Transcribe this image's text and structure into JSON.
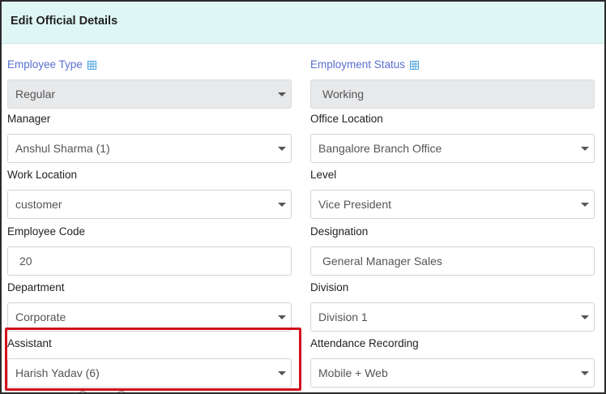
{
  "header": {
    "title": "Edit Official Details"
  },
  "fields": [
    {
      "label": "Employee Type",
      "value": "Regular",
      "kind": "select",
      "disabled": true,
      "label_color": "blue",
      "label_icon": "grid-icon"
    },
    {
      "label": "Employment Status",
      "value": "Working",
      "kind": "text",
      "disabled": true,
      "label_color": "blue",
      "label_icon": "grid-icon"
    },
    {
      "label": "Manager",
      "value": "Anshul Sharma (1)",
      "kind": "select"
    },
    {
      "label": "Office Location",
      "value": "Bangalore Branch Office",
      "kind": "select"
    },
    {
      "label": "Work Location",
      "value": "customer",
      "kind": "select"
    },
    {
      "label": "Level",
      "value": "Vice President",
      "kind": "select"
    },
    {
      "label": "Employee Code",
      "value": "20",
      "kind": "text"
    },
    {
      "label": "Designation",
      "value": "General Manager Sales",
      "kind": "text"
    },
    {
      "label": "Department",
      "value": "Corporate",
      "kind": "select"
    },
    {
      "label": "Division",
      "value": "Division 1",
      "kind": "select"
    },
    {
      "label": "Assistant",
      "value": "Harish Yadav (6)",
      "kind": "select",
      "highlighted": true
    },
    {
      "label": "Attendance Recording",
      "value": "Mobile + Web",
      "kind": "select"
    }
  ],
  "colors": {
    "header_bg": "#dff7f4",
    "link_label": "#5a6fd0",
    "highlight": "#d0101e",
    "disabled_bg": "#e8e9eb"
  }
}
